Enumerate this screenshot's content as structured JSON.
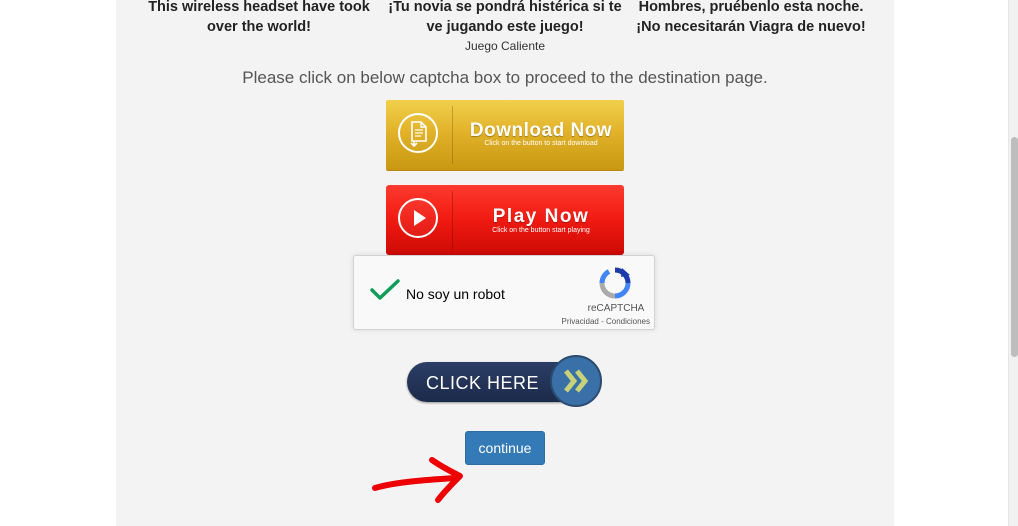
{
  "ads": [
    {
      "text": "This wireless headset have took over the world!",
      "source": ""
    },
    {
      "text": "¡Tu novia se pondrá histérica si te ve jugando este juego!",
      "source": "Juego Caliente"
    },
    {
      "text": "Hombres, pruébenlo esta noche. ¡No necesitarán Viagra de nuevo!",
      "source": ""
    }
  ],
  "instruction": "Please click on below captcha box to proceed to the destination page.",
  "download_button": {
    "title": "Download Now",
    "subtitle": "Click on the button to start download",
    "icon": "download-document-icon",
    "color": "#e2b22a"
  },
  "play_button": {
    "title": "Play Now",
    "subtitle": "Click on the button start playing",
    "icon": "play-icon",
    "color": "#f01a12"
  },
  "recaptcha": {
    "checked": true,
    "label": "No soy un robot",
    "brand": "reCAPTCHA",
    "links": "Privacidad - Condiciones",
    "icon": "recaptcha-logo-icon"
  },
  "click_here_button": {
    "label": "CLICK HERE",
    "icon": "double-chevron-right-icon"
  },
  "continue_button": {
    "label": "continue",
    "color": "#337ab7"
  },
  "annotation": {
    "icon": "red-arrow-icon",
    "color": "#ee0000"
  }
}
